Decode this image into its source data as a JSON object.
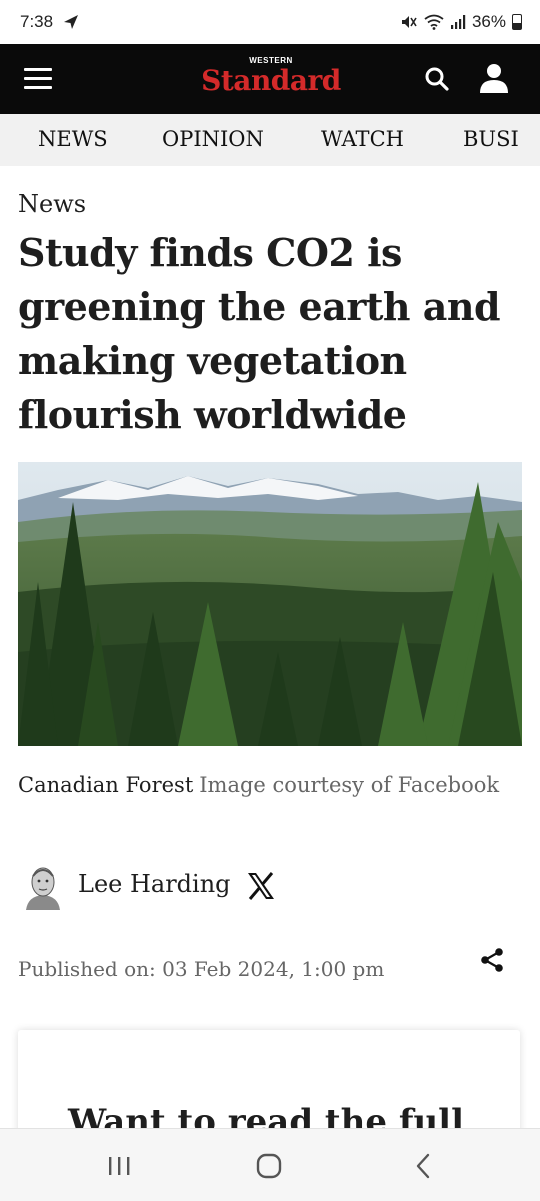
{
  "status_bar": {
    "time": "7:38",
    "battery": "36%",
    "icons": [
      "navigation-arrow-icon",
      "mute-icon",
      "wifi-icon",
      "signal-icon",
      "battery-icon"
    ]
  },
  "header": {
    "logo_top": "WESTERN",
    "logo_main": "Standard",
    "logo_color": "#d42a2a",
    "background": "#0a0a0a"
  },
  "nav": {
    "items": [
      "NEWS",
      "OPINION",
      "WATCH",
      "BUSI"
    ]
  },
  "article": {
    "kicker": "News",
    "headline": "Study finds CO2 is greening the earth and making vegetation flourish worldwide",
    "caption_title": "Canadian Forest",
    "caption_credit": "Image courtesy of Facebook",
    "author": "Lee Harding",
    "published": "Published on: 03 Feb 2024, 1:00 pm"
  },
  "paywall": {
    "heading": "Want to read the full"
  }
}
